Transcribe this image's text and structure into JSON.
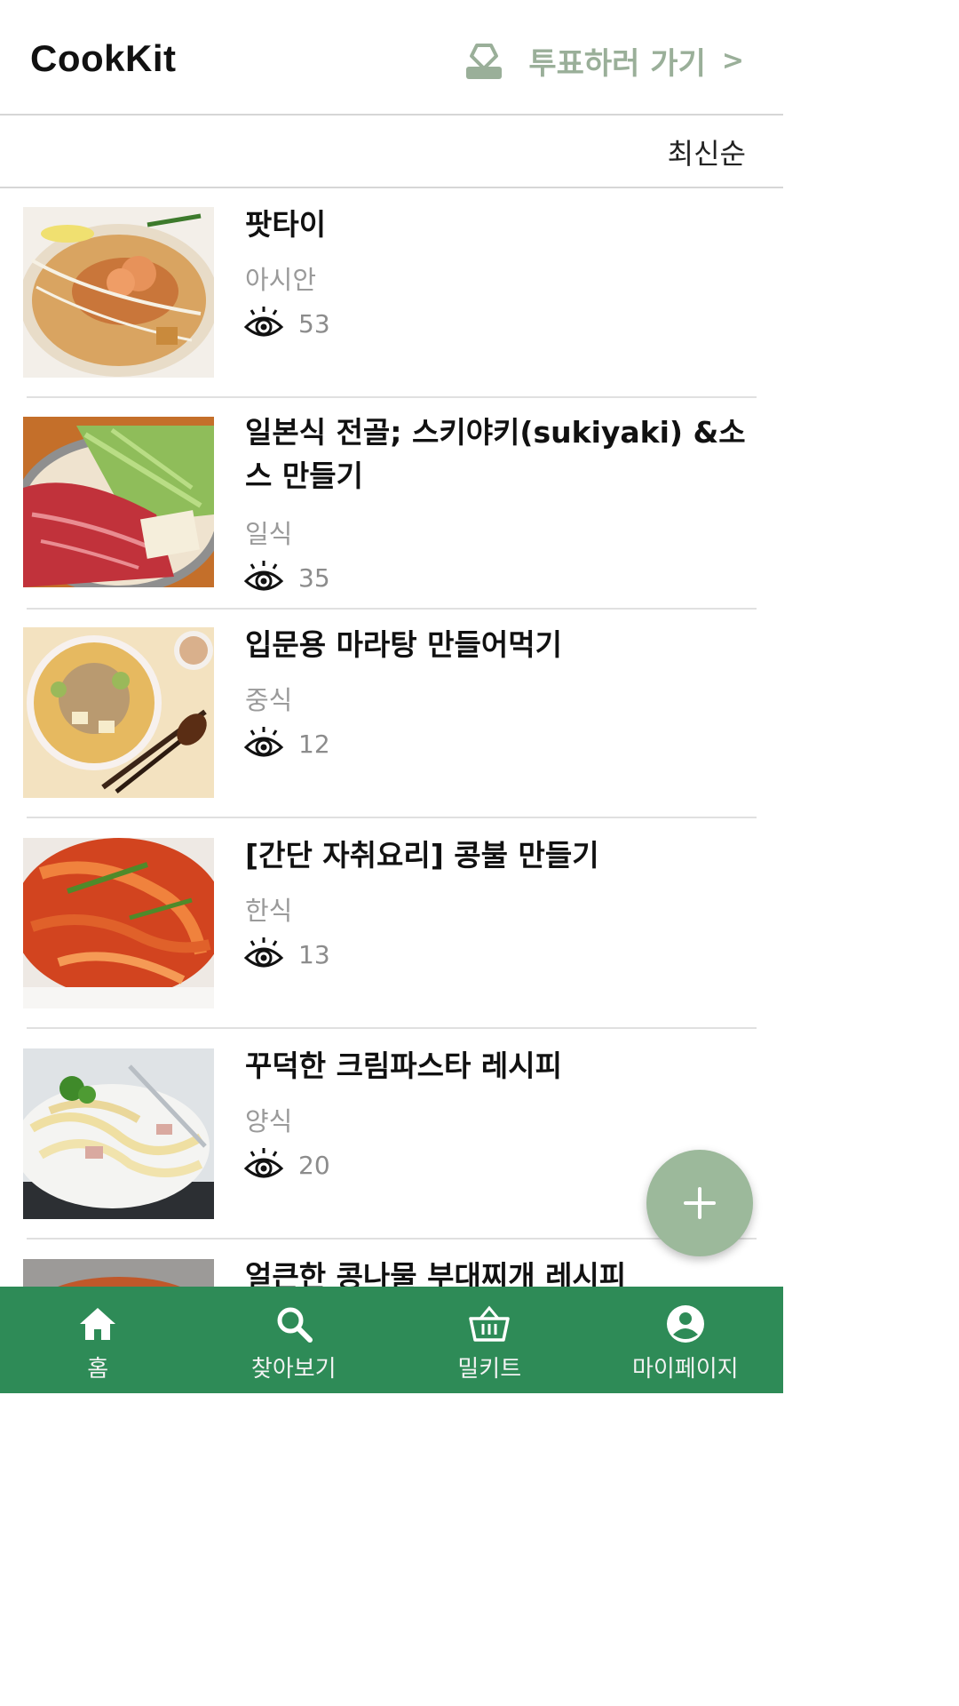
{
  "header": {
    "app_title": "CookKit",
    "vote_label": "투표하러 가기",
    "vote_chevron": ">"
  },
  "sort": {
    "label": "최신순"
  },
  "recipes": [
    {
      "title": "팟타이",
      "category": "아시안",
      "views": "53"
    },
    {
      "title": "일본식 전골; 스키야키(sukiyaki) &소스 만들기",
      "category": "일식",
      "views": "35"
    },
    {
      "title": "입문용 마라탕 만들어먹기",
      "category": "중식",
      "views": "12"
    },
    {
      "title": "[간단 자취요리] 콩불 만들기",
      "category": "한식",
      "views": "13"
    },
    {
      "title": "꾸덕한 크림파스타 레시피",
      "category": "양식",
      "views": "20"
    },
    {
      "title": "얼큰한 콩나물 부대찌개 레시피",
      "category": "",
      "views": ""
    }
  ],
  "fab": {
    "icon": "plus-icon"
  },
  "bottom_nav": [
    {
      "label": "홈",
      "icon": "home-icon"
    },
    {
      "label": "찾아보기",
      "icon": "search-icon"
    },
    {
      "label": "밀키트",
      "icon": "basket-icon"
    },
    {
      "label": "마이페이지",
      "icon": "account-icon"
    }
  ],
  "colors": {
    "accent": "#2e8b57",
    "vote": "#9aaf99",
    "fab": "#9cb99b",
    "muted": "#9a9a9a"
  }
}
